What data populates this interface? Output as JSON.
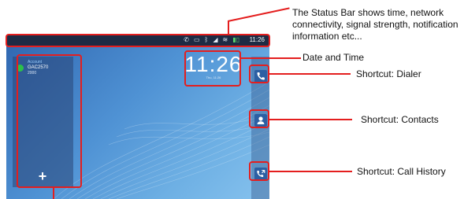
{
  "status_bar": {
    "time": "11:26",
    "icons": [
      "call-forward-icon",
      "voicemail-icon",
      "bluetooth-icon",
      "signal-icon",
      "wifi-icon",
      "battery-icon"
    ]
  },
  "clock": {
    "time": "11:26",
    "date": "Thu, 11:26"
  },
  "account": {
    "header": "Account",
    "name": "GAC2570",
    "number": "2000",
    "add_label": "+"
  },
  "shortcuts": [
    {
      "icon": "phone-icon"
    },
    {
      "icon": "contacts-icon"
    },
    {
      "icon": "call-history-icon"
    }
  ],
  "annotations": {
    "status_bar": "The Status Bar shows time, network connectivity, signal strength, notification information etc...",
    "date_time": "Date and Time",
    "dialer": "Shortcut: Dialer",
    "contacts": "Shortcut: Contacts",
    "call_history": "Shortcut: Call History"
  },
  "colors": {
    "annotation": "#e41e1e",
    "status_bar_bg": "#1d2b44",
    "wallpaper_start": "#2f66b0",
    "wallpaper_end": "#86c2ee"
  }
}
